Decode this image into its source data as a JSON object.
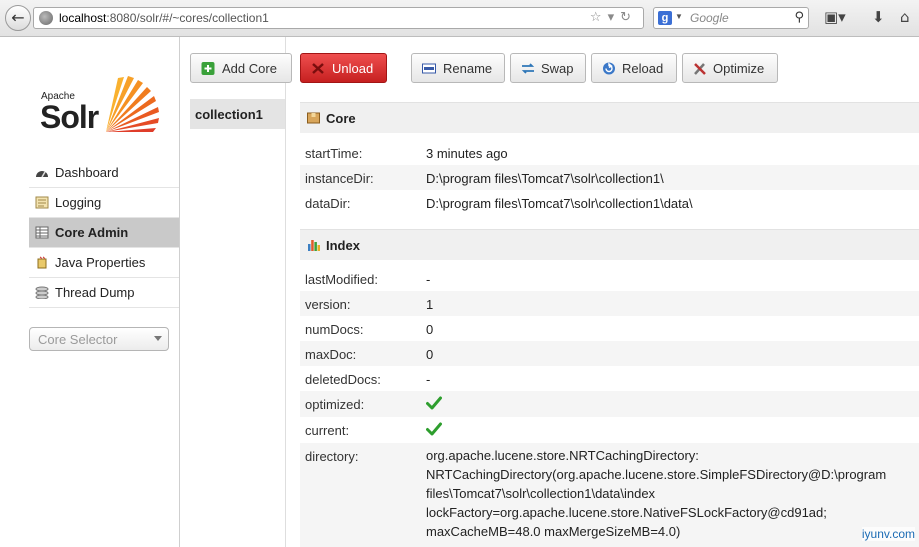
{
  "browser": {
    "url_host": "localhost",
    "url_rest": ":8080/solr/#/~cores/collection1",
    "search_placeholder": "Google",
    "search_engine_letter": "g"
  },
  "logo": {
    "apache": "Apache",
    "solr": "Solr"
  },
  "sidebar": {
    "items": [
      {
        "label": "Dashboard",
        "icon": "dashboard-icon"
      },
      {
        "label": "Logging",
        "icon": "logging-icon"
      },
      {
        "label": "Core Admin",
        "icon": "core-admin-icon",
        "active": true
      },
      {
        "label": "Java Properties",
        "icon": "java-properties-icon"
      },
      {
        "label": "Thread Dump",
        "icon": "thread-dump-icon"
      }
    ],
    "core_selector": "Core Selector"
  },
  "cores": [
    "collection1"
  ],
  "toolbar": {
    "add_core": "Add Core",
    "unload": "Unload",
    "rename": "Rename",
    "swap": "Swap",
    "reload": "Reload",
    "optimize": "Optimize"
  },
  "core_section": {
    "title": "Core",
    "rows": [
      {
        "key": "startTime:",
        "value": "3 minutes ago"
      },
      {
        "key": "instanceDir:",
        "value": "D:\\program files\\Tomcat7\\solr\\collection1\\"
      },
      {
        "key": "dataDir:",
        "value": "D:\\program files\\Tomcat7\\solr\\collection1\\data\\"
      }
    ]
  },
  "index_section": {
    "title": "Index",
    "rows": [
      {
        "key": "lastModified:",
        "value": "-"
      },
      {
        "key": "version:",
        "value": "1"
      },
      {
        "key": "numDocs:",
        "value": "0"
      },
      {
        "key": "maxDoc:",
        "value": "0"
      },
      {
        "key": "deletedDocs:",
        "value": "-"
      },
      {
        "key": "optimized:",
        "value": ""
      },
      {
        "key": "current:",
        "value": ""
      },
      {
        "key": "directory:",
        "value": "org.apache.lucene.store.NRTCachingDirectory: NRTCachingDirectory(org.apache.lucene.store.SimpleFSDirectory@D:\\program files\\Tomcat7\\solr\\collection1\\data\\index lockFactory=org.apache.lucene.store.NativeFSLockFactory@cd91ad; maxCacheMB=48.0 maxMergeSizeMB=4.0)"
      }
    ]
  },
  "watermark": "iyunv.com",
  "colors": {
    "unload": "#d42a2a",
    "check": "#2e9e2e",
    "active_nav": "#c9c9c9"
  }
}
